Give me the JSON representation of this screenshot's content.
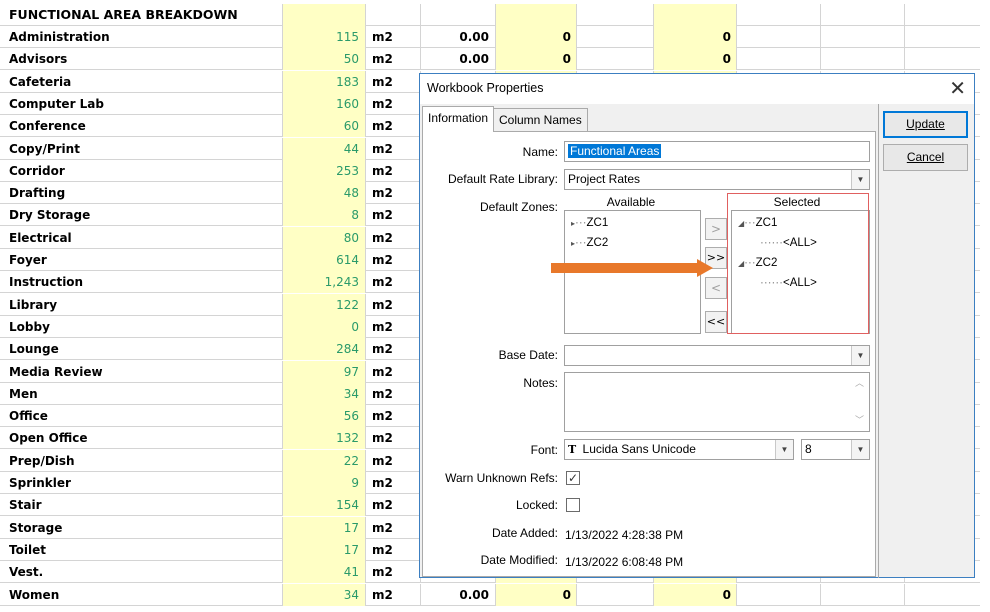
{
  "sheet": {
    "heading": "FUNCTIONAL AREA BREAKDOWN",
    "rows": [
      {
        "name": "Administration",
        "area": "115",
        "unit": "m2",
        "val": "0.00",
        "y1": "0",
        "y2": "0"
      },
      {
        "name": "Advisors",
        "area": "50",
        "unit": "m2",
        "val": "0.00",
        "y1": "0",
        "y2": "0"
      },
      {
        "name": "Cafeteria",
        "area": "183",
        "unit": "m2",
        "val": "",
        "y1": "",
        "y2": ""
      },
      {
        "name": "Computer Lab",
        "area": "160",
        "unit": "m2",
        "val": "",
        "y1": "",
        "y2": ""
      },
      {
        "name": "Conference",
        "area": "60",
        "unit": "m2",
        "val": "",
        "y1": "",
        "y2": ""
      },
      {
        "name": "Copy/Print",
        "area": "44",
        "unit": "m2",
        "val": "",
        "y1": "",
        "y2": ""
      },
      {
        "name": "Corridor",
        "area": "253",
        "unit": "m2",
        "val": "",
        "y1": "",
        "y2": ""
      },
      {
        "name": "Drafting",
        "area": "48",
        "unit": "m2",
        "val": "",
        "y1": "",
        "y2": ""
      },
      {
        "name": "Dry Storage",
        "area": "8",
        "unit": "m2",
        "val": "",
        "y1": "",
        "y2": ""
      },
      {
        "name": "Electrical",
        "area": "80",
        "unit": "m2",
        "val": "",
        "y1": "",
        "y2": ""
      },
      {
        "name": "Foyer",
        "area": "614",
        "unit": "m2",
        "val": "",
        "y1": "",
        "y2": ""
      },
      {
        "name": "Instruction",
        "area": "1,243",
        "unit": "m2",
        "val": "",
        "y1": "",
        "y2": ""
      },
      {
        "name": "Library",
        "area": "122",
        "unit": "m2",
        "val": "",
        "y1": "",
        "y2": ""
      },
      {
        "name": "Lobby",
        "area": "0",
        "unit": "m2",
        "val": "",
        "y1": "",
        "y2": ""
      },
      {
        "name": "Lounge",
        "area": "284",
        "unit": "m2",
        "val": "",
        "y1": "",
        "y2": ""
      },
      {
        "name": "Media Review",
        "area": "97",
        "unit": "m2",
        "val": "",
        "y1": "",
        "y2": ""
      },
      {
        "name": "Men",
        "area": "34",
        "unit": "m2",
        "val": "",
        "y1": "",
        "y2": ""
      },
      {
        "name": "Office",
        "area": "56",
        "unit": "m2",
        "val": "",
        "y1": "",
        "y2": ""
      },
      {
        "name": "Open Office",
        "area": "132",
        "unit": "m2",
        "val": "",
        "y1": "",
        "y2": ""
      },
      {
        "name": "Prep/Dish",
        "area": "22",
        "unit": "m2",
        "val": "",
        "y1": "",
        "y2": ""
      },
      {
        "name": "Sprinkler",
        "area": "9",
        "unit": "m2",
        "val": "",
        "y1": "",
        "y2": ""
      },
      {
        "name": "Stair",
        "area": "154",
        "unit": "m2",
        "val": "",
        "y1": "",
        "y2": ""
      },
      {
        "name": "Storage",
        "area": "17",
        "unit": "m2",
        "val": "",
        "y1": "",
        "y2": ""
      },
      {
        "name": "Toilet",
        "area": "17",
        "unit": "m2",
        "val": "",
        "y1": "",
        "y2": ""
      },
      {
        "name": "Vest.",
        "area": "41",
        "unit": "m2",
        "val": "",
        "y1": "",
        "y2": ""
      },
      {
        "name": "Women",
        "area": "34",
        "unit": "m2",
        "val": "0.00",
        "y1": "0",
        "y2": "0"
      }
    ]
  },
  "dialog": {
    "title": "Workbook Properties",
    "close_icon": "close-icon",
    "tabs": {
      "information": "Information",
      "column_names": "Column Names"
    },
    "labels": {
      "name": "Name:",
      "rate_library": "Default Rate Library:",
      "zones": "Default Zones:",
      "available": "Available",
      "selected": "Selected",
      "base_date": "Base Date:",
      "notes": "Notes:",
      "font": "Font:",
      "warn_unknown": "Warn Unknown Refs:",
      "locked": "Locked:",
      "date_added": "Date Added:",
      "date_modified": "Date Modified:"
    },
    "values": {
      "name": "Functional Areas",
      "rate_library": "Project Rates",
      "base_date": "",
      "notes": "",
      "font": "Lucida Sans Unicode",
      "font_size": "8",
      "warn_unknown": true,
      "locked": false,
      "date_added": "1/13/2022 4:28:38 PM",
      "date_modified": "1/13/2022 6:08:48 PM"
    },
    "available_zones": [
      "ZC1",
      "ZC2"
    ],
    "selected_zones": [
      {
        "zone": "ZC1",
        "child": "<ALL>"
      },
      {
        "zone": "ZC2",
        "child": "<ALL>"
      }
    ],
    "move_buttons": {
      "add_one": ">",
      "add_all": ">>",
      "remove_one": "<",
      "remove_all": "<<"
    },
    "buttons": {
      "update": "Update",
      "cancel": "Cancel"
    },
    "accent_color": "#0078d7",
    "arrow_color": "#e8782a",
    "highlight_color": "#e06060"
  }
}
